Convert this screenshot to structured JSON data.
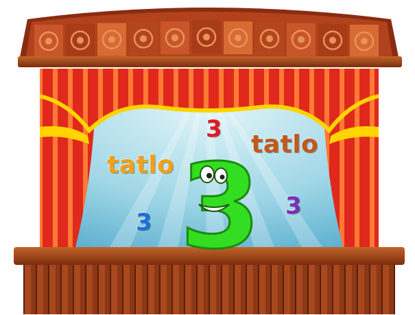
{
  "scene": {
    "words": [
      {
        "text": "tatlo",
        "color": "#f2a11a"
      },
      {
        "text": "tatlo",
        "color": "#c05a1e"
      }
    ],
    "numerals": [
      {
        "text": "3",
        "color": "#e01b24"
      },
      {
        "text": "3",
        "color": "#1f6fd6"
      },
      {
        "text": "3",
        "color": "#7a2fb8"
      }
    ],
    "mascot": {
      "text": "3",
      "color": "#33dd22",
      "icon": "smiling-three-character"
    }
  },
  "colors": {
    "curtain_red": "#e8321e",
    "curtain_stripe": "#ff8a3a",
    "valance_yellow": "#ffd400",
    "backdrop": "#a8dcea",
    "wood": "#8a3a1a"
  }
}
